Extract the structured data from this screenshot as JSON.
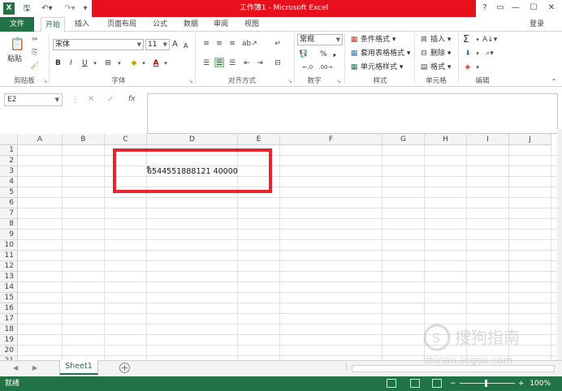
{
  "window": {
    "title": "工作簿1 - Microsoft Excel",
    "login": "登录",
    "controls": [
      "?",
      "▭",
      "—",
      "☐",
      "✕"
    ]
  },
  "tabs": [
    {
      "label": "文件",
      "kind": "file"
    },
    {
      "label": "开始",
      "kind": "active"
    },
    {
      "label": "插入",
      "kind": ""
    },
    {
      "label": "页面布局",
      "kind": ""
    },
    {
      "label": "公式",
      "kind": ""
    },
    {
      "label": "数据",
      "kind": ""
    },
    {
      "label": "审阅",
      "kind": ""
    },
    {
      "label": "视图",
      "kind": ""
    }
  ],
  "ribbon": {
    "clipboard": {
      "paste": "粘贴",
      "label": "剪贴板"
    },
    "font": {
      "name": "宋体",
      "size": "11",
      "bold": "B",
      "italic": "I",
      "underline": "U",
      "grow": "A",
      "shrink": "A",
      "label": "字体"
    },
    "alignment": {
      "label": "对齐方式"
    },
    "number": {
      "format": "常规",
      "percent": "%",
      "comma": "❟",
      "label": "数字"
    },
    "styles": {
      "conditional": "条件格式",
      "table": "套用表格格式",
      "cell": "单元格样式",
      "label": "样式"
    },
    "cells": {
      "insert": "插入",
      "delete": "删除",
      "format": "格式",
      "label": "单元格"
    },
    "editing": {
      "sum": "Σ",
      "label": "编辑"
    }
  },
  "formula_bar": {
    "name_box": "E2",
    "cancel": "✕",
    "enter": "✓",
    "fx": "fx",
    "content": ""
  },
  "grid": {
    "columns": [
      "A",
      "B",
      "C",
      "D",
      "E",
      "F",
      "G",
      "H",
      "I",
      "J"
    ],
    "rows": [
      "1",
      "2",
      "3",
      "4",
      "5",
      "6",
      "7",
      "8",
      "9",
      "10",
      "11",
      "12",
      "13",
      "14",
      "15",
      "16",
      "17",
      "18",
      "19",
      "20",
      "21"
    ],
    "cell_value": "6544551888121 40000"
  },
  "sheets": {
    "active": "Sheet1",
    "add": "+"
  },
  "status": {
    "ready": "就绪",
    "zoom": "100%",
    "minus": "−",
    "plus": "+"
  },
  "watermark": {
    "text": "搜狗指南",
    "sub": "zhinan.sogou.com"
  },
  "colors": {
    "excel_green": "#217346",
    "title_red": "#e8101c",
    "highlight_red": "#e8242e"
  }
}
